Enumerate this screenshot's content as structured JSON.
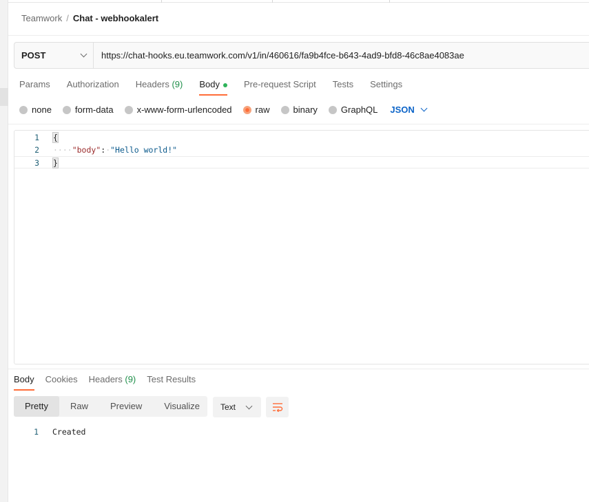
{
  "breadcrumb": {
    "parent": "Teamwork",
    "separator": "/",
    "current": "Chat - webhookalert"
  },
  "request": {
    "method": "POST",
    "url": "https://chat-hooks.eu.teamwork.com/v1/in/460616/fa9b4fce-b643-4ad9-bfd8-46c8ae4083ae"
  },
  "request_tabs": [
    {
      "label": "Params"
    },
    {
      "label": "Authorization"
    },
    {
      "label": "Headers",
      "count": "(9)"
    },
    {
      "label": "Body",
      "active": true,
      "indicator": "green-dot"
    },
    {
      "label": "Pre-request Script"
    },
    {
      "label": "Tests"
    },
    {
      "label": "Settings"
    }
  ],
  "body_modes": {
    "options": [
      "none",
      "form-data",
      "x-www-form-urlencoded",
      "raw",
      "binary",
      "GraphQL"
    ],
    "selected": "raw",
    "language": "JSON"
  },
  "editor": {
    "lines": [
      {
        "n": "1",
        "text": "{"
      },
      {
        "n": "2",
        "key": "\"body\"",
        "colon": ":",
        "value": "\"Hello world!\""
      },
      {
        "n": "3",
        "text": "}"
      }
    ]
  },
  "response_tabs": [
    {
      "label": "Body",
      "active": true
    },
    {
      "label": "Cookies"
    },
    {
      "label": "Headers",
      "count": "(9)"
    },
    {
      "label": "Test Results"
    }
  ],
  "response_view": {
    "modes": [
      "Pretty",
      "Raw",
      "Preview",
      "Visualize"
    ],
    "selected": "Pretty",
    "format": "Text",
    "wrap_icon": "wrap-lines-icon"
  },
  "response_body": {
    "lines": [
      {
        "n": "1",
        "text": "Created"
      }
    ]
  },
  "colors": {
    "accent": "#ff6c37",
    "json_select": "#0c64c8",
    "header_count": "#1f8f4a",
    "body_dot": "#2eb35a"
  }
}
